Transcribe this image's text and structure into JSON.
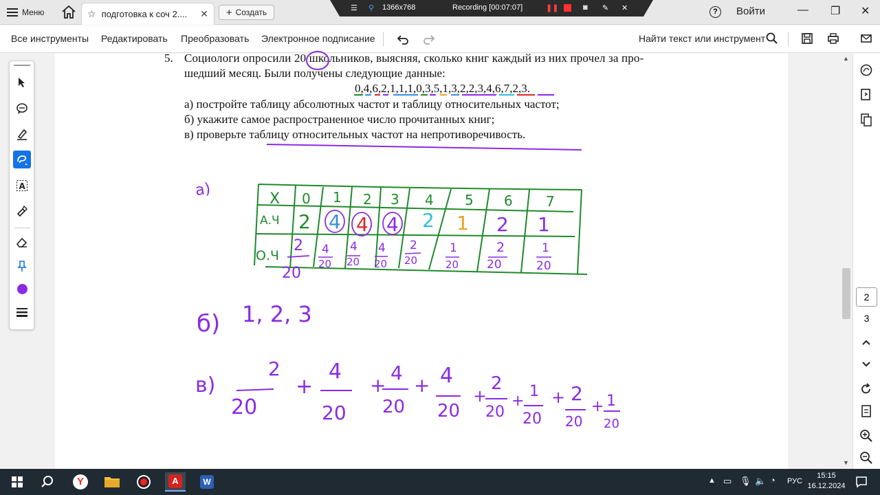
{
  "titlebar": {
    "menu_label": "Меню",
    "tab_title": "подготовка к соч 2....",
    "create_label": "Создать",
    "help_label": "?",
    "signin_label": "Войти"
  },
  "recording": {
    "resolution": "1366x768",
    "status": "Recording [00:07:07]"
  },
  "toolbar": {
    "all_tools": "Все инструменты",
    "edit": "Редактировать",
    "convert": "Преобразовать",
    "esign": "Электронное подписание",
    "find": "Найти текст или инструмент"
  },
  "document": {
    "task_number": "5.",
    "line1": "Социологи опросили 20 школьников, выясняя, сколько книг каждый из них прочел за про-",
    "line2": "шедший месяц. Были получены следующие данные:",
    "data_line": "0,4,6,2,1,1,1,0,3,5,1,3,2,2,3,4,6,7,2,3.",
    "item_a": "а) постройте таблицу абсолютных частот и таблицу относительных частот;",
    "item_b": "б) укажите самое распространенное число прочитанных книг;",
    "item_c": "в) проверьте таблицу относительных частот на непротиворечивость."
  },
  "handwriting": {
    "label_a": "a)",
    "label_b": "б)",
    "label_c": "в)",
    "header_x": "X",
    "row_abs": "А.Ч",
    "row_rel": "О.Ч",
    "x_values": [
      "0",
      "1",
      "2",
      "3",
      "4",
      "5",
      "6",
      "7"
    ],
    "abs_values": [
      "2",
      "4",
      "4",
      "4",
      "2",
      "1",
      "2",
      "1"
    ],
    "rel_numerators": [
      "2",
      "4",
      "4",
      "4",
      "2",
      "1",
      "2",
      "1"
    ],
    "rel_denominator": "20",
    "answer_b": "1, 2, 3",
    "sum_numerators": [
      "2",
      "4",
      "4",
      "4",
      "2",
      "1",
      "2",
      "1"
    ],
    "sum_denominator": "20",
    "plus": "+"
  },
  "navigation": {
    "current_page": "2",
    "total_pages": "3"
  },
  "taskbar": {
    "language": "РУС",
    "time": "15:15",
    "date": "16.12.2024"
  },
  "colors": {
    "accent": "#1473e6",
    "ink_green": "#1f8a2a",
    "ink_purple": "#8a2be2",
    "ink_red": "#d42a2a",
    "ink_blue": "#3a8de0",
    "ink_cyan": "#2fbfd8",
    "ink_orange": "#f0a020"
  }
}
